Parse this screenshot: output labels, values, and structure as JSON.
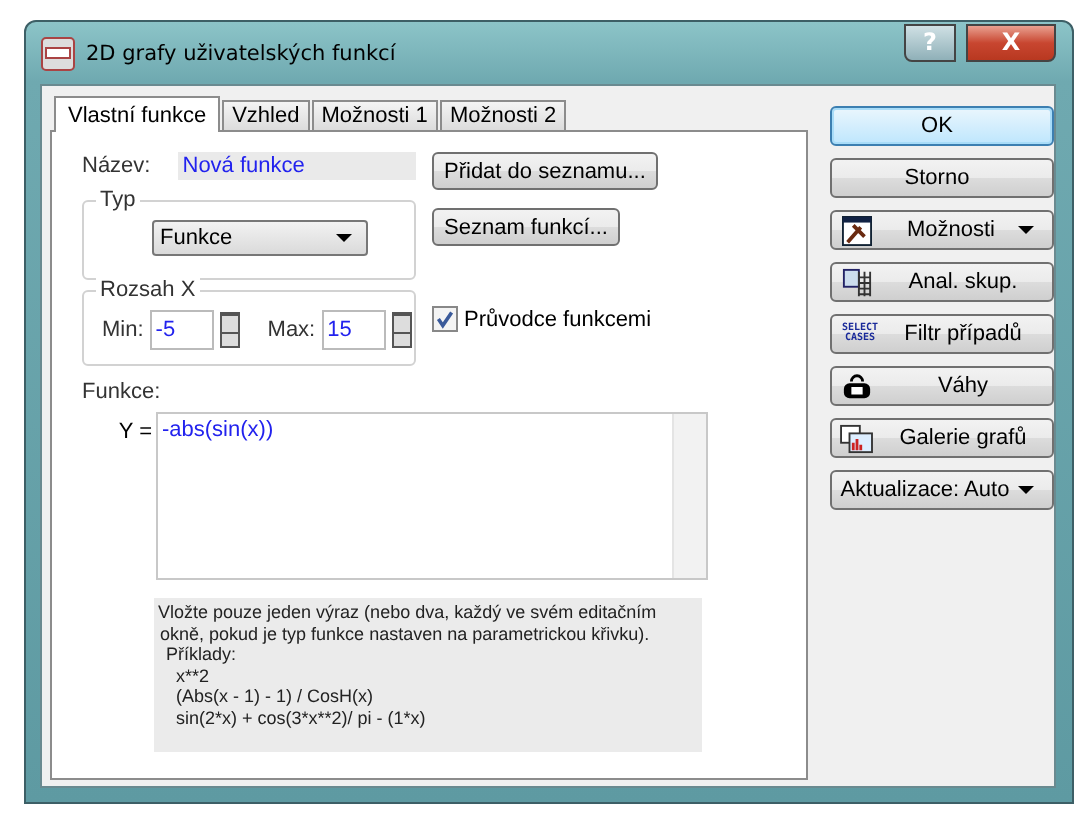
{
  "window": {
    "title": "2D grafy uživatelských funkcí",
    "help_button": "?",
    "close_button": "X"
  },
  "tabs": [
    {
      "label": "Vlastní funkce",
      "selected": true
    },
    {
      "label": "Vzhled",
      "selected": false
    },
    {
      "label": "Možnosti 1",
      "selected": false
    },
    {
      "label": "Možnosti 2",
      "selected": false
    }
  ],
  "name": {
    "label": "Název:",
    "value": "Nová funkce"
  },
  "type_group": {
    "title": "Typ",
    "dropdown": "Funkce"
  },
  "range_group": {
    "title": "Rozsah X",
    "min_label": "Min:",
    "min_value": "-5",
    "max_label": "Max:",
    "max_value": "15"
  },
  "side_buttons": [
    "Přidat do seznamu...",
    "Seznam funkcí..."
  ],
  "wizard_checkbox": {
    "label": "Průvodce funkcemi",
    "checked": true
  },
  "function": {
    "label": "Funkce:",
    "y_label": "Y =",
    "value": "-abs(sin(x))"
  },
  "help_lines": [
    "Vložte pouze jeden výraz (nebo dva, každý ve svém editačním",
    "okně, pokud je typ funkce nastaven na parametrickou křivku).",
    "Příklady:",
    "x**2",
    "(Abs(x - 1) - 1) / CosH(x)",
    "sin(2*x) + cos(3*x**2)/ pi - (1*x)"
  ],
  "buttons": [
    {
      "kind": "default",
      "label": "OK"
    },
    {
      "kind": "plain",
      "label": "Storno"
    },
    {
      "kind": "menu",
      "label": "Možnosti"
    },
    {
      "kind": "icon",
      "label": "Anal. skup."
    },
    {
      "kind": "text_icon",
      "icon_text": "SELECT CASES",
      "label": "Filtr případů"
    },
    {
      "kind": "icon",
      "label": "Váhy"
    },
    {
      "kind": "icon",
      "label": "Galerie grafů"
    },
    {
      "kind": "dropdown",
      "label": "Aktualizace: Auto"
    }
  ]
}
